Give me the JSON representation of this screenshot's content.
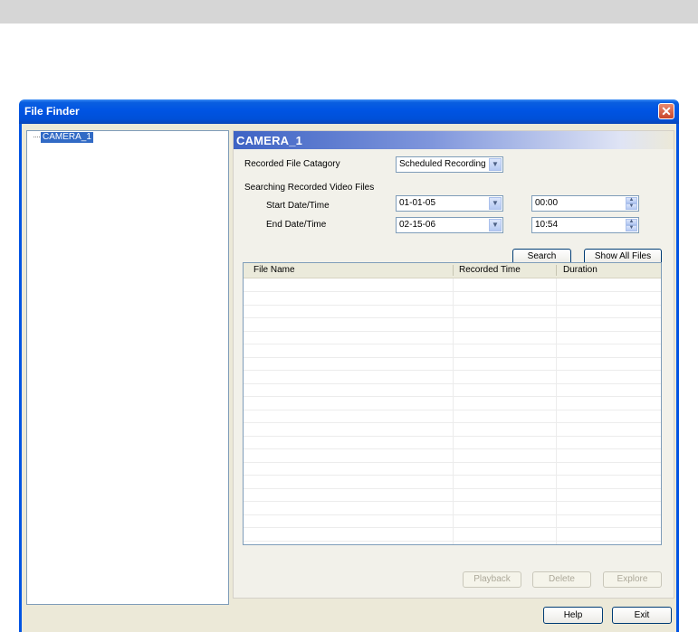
{
  "window": {
    "title": "File Finder",
    "close_glyph": "✕"
  },
  "tree": {
    "nodes": [
      {
        "label": "CAMERA_1"
      }
    ]
  },
  "panel": {
    "header": "CAMERA_1",
    "category_label": "Recorded File Catagory",
    "category_value": "Scheduled Recording",
    "search_section_label": "Searching Recorded Video Files",
    "start_label": "Start Date/Time",
    "start_date": "01-01-05",
    "start_time": "00:00",
    "end_label": "End Date/Time",
    "end_date": "02-15-06",
    "end_time": "10:54",
    "search_button": "Search",
    "show_all_button": "Show All Files"
  },
  "list": {
    "columns": [
      "File Name",
      "Recorded Time",
      "Duration"
    ],
    "rows": []
  },
  "actions": {
    "playback": "Playback",
    "delete": "Delete",
    "explore": "Explore"
  },
  "footer": {
    "help": "Help",
    "exit": "Exit"
  },
  "icons": {
    "dropdown": "chevron-down-icon",
    "spin_up": "arrow-up-icon",
    "spin_down": "arrow-down-icon",
    "close": "close-icon"
  },
  "colors": {
    "titlebar": "#0054e3",
    "selection": "#316ac5",
    "dialog_bg": "#ece9d8"
  }
}
